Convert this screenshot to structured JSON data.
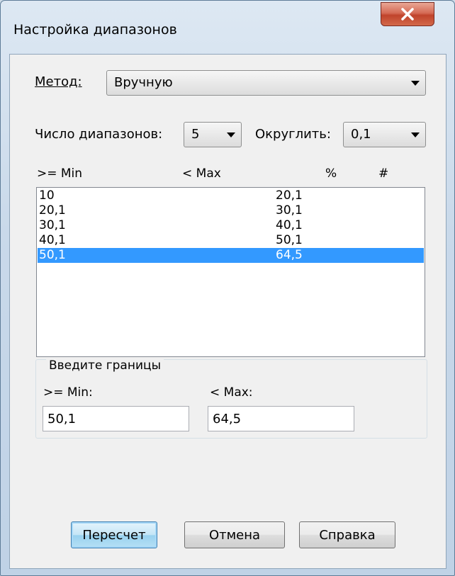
{
  "window": {
    "title": "Настройка диапазонов"
  },
  "method": {
    "label": "Метод:",
    "value": "Вручную"
  },
  "ranges_count": {
    "label": "Число диапазонов:",
    "value": "5"
  },
  "round": {
    "label": "Округлить:",
    "value": "0,1"
  },
  "list": {
    "headers": [
      ">= Min",
      "< Max",
      "%",
      "#"
    ],
    "rows": [
      {
        "min": "10",
        "max": "20,1"
      },
      {
        "min": "20,1",
        "max": "30,1"
      },
      {
        "min": "30,1",
        "max": "40,1"
      },
      {
        "min": "40,1",
        "max": "50,1"
      },
      {
        "min": "50,1",
        "max": "64,5"
      }
    ],
    "selected_index": 4
  },
  "bounds": {
    "group_label": "Введите границы",
    "min_label": ">= Min:",
    "max_label": "< Max:",
    "min_value": "50,1",
    "max_value": "64,5"
  },
  "buttons": {
    "recalc": "Пересчет",
    "cancel": "Отмена",
    "help": "Справка"
  },
  "colors": {
    "selection": "#3399ff",
    "close_button": "#c0442c"
  }
}
